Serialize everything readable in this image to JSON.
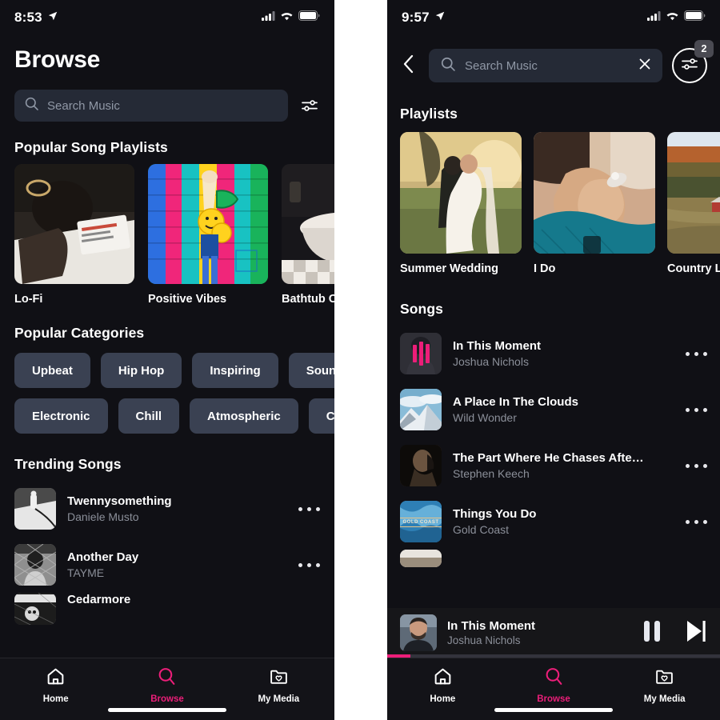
{
  "left": {
    "status": {
      "time": "8:53",
      "location_icon": "location-arrow-icon",
      "cellular_icon": "cellular-signal-icon",
      "wifi_icon": "wifi-icon",
      "battery_icon": "battery-icon"
    },
    "page_title": "Browse",
    "search": {
      "placeholder": "Search Music",
      "icon": "search-icon"
    },
    "filter_icon": "sliders-filter-icon",
    "playlists_section": {
      "title": "Popular Song Playlists",
      "items": [
        {
          "label": "Lo-Fi",
          "art": "art-lofi"
        },
        {
          "label": "Positive Vibes",
          "art": "art-vibes"
        },
        {
          "label": "Bathtub Ch",
          "art": "art-bath"
        }
      ]
    },
    "categories_section": {
      "title": "Popular Categories",
      "items": [
        "Upbeat",
        "Hip Hop",
        "Inspiring",
        "Soundtr",
        "Electronic",
        "Chill",
        "Atmospheric",
        "Calm"
      ]
    },
    "trending_section": {
      "title": "Trending Songs",
      "items": [
        {
          "title": "Twennysomething",
          "artist": "Daniele Musto",
          "art": "art-twenny",
          "menu_icon": "more-options-icon"
        },
        {
          "title": "Another Day",
          "artist": "TAYME",
          "art": "art-another",
          "menu_icon": "more-options-icon"
        },
        {
          "title": "Cedarmore",
          "artist": "",
          "art": "art-cedar",
          "menu_icon": "more-options-icon"
        }
      ]
    },
    "tabs": [
      {
        "label": "Home",
        "icon": "home-icon",
        "active": false
      },
      {
        "label": "Browse",
        "icon": "search-icon",
        "active": true
      },
      {
        "label": "My Media",
        "icon": "folder-heart-icon",
        "active": false
      }
    ]
  },
  "right": {
    "status": {
      "time": "9:57",
      "location_icon": "location-arrow-icon",
      "cellular_icon": "cellular-signal-icon",
      "wifi_icon": "wifi-icon",
      "battery_icon": "battery-icon"
    },
    "back_icon": "chevron-left-icon",
    "search": {
      "placeholder": "Search Music",
      "icon": "search-icon",
      "clear_icon": "close-x-icon"
    },
    "filter": {
      "icon": "sliders-filter-icon",
      "badge": "2"
    },
    "playlists_section": {
      "title": "Playlists",
      "items": [
        {
          "label": "Summer Wedding",
          "art": "art-wed"
        },
        {
          "label": "I Do",
          "art": "art-ido"
        },
        {
          "label": "Country Lif",
          "art": "art-country"
        }
      ]
    },
    "songs_section": {
      "title": "Songs",
      "items": [
        {
          "title": "In This Moment",
          "artist": "Joshua Nichols",
          "art": "art-moment",
          "playing": true,
          "menu_icon": "more-options-icon"
        },
        {
          "title": "A Place In The Clouds",
          "artist": "Wild Wonder",
          "art": "art-clouds",
          "playing": false,
          "menu_icon": "more-options-icon"
        },
        {
          "title": "The Part Where He Chases Afte…",
          "artist": "Stephen Keech",
          "art": "art-part",
          "playing": false,
          "menu_icon": "more-options-icon"
        },
        {
          "title": "Things You Do",
          "artist": "Gold Coast",
          "art": "art-things",
          "playing": false,
          "menu_icon": "more-options-icon",
          "art_badge": "GOLD COAST"
        }
      ]
    },
    "mini_player": {
      "title": "In This Moment",
      "artist": "Joshua Nichols",
      "art": "art-face",
      "pause_icon": "pause-icon",
      "next_icon": "next-track-icon",
      "progress_percent": 7
    },
    "tabs": [
      {
        "label": "Home",
        "icon": "home-icon",
        "active": false
      },
      {
        "label": "Browse",
        "icon": "search-icon",
        "active": true
      },
      {
        "label": "My Media",
        "icon": "folder-heart-icon",
        "active": false
      }
    ]
  },
  "colors": {
    "accent": "#ec1e79",
    "background": "#101015",
    "surface": "#252a36",
    "chip": "#3a4152",
    "muted_text": "#8b8f99"
  }
}
